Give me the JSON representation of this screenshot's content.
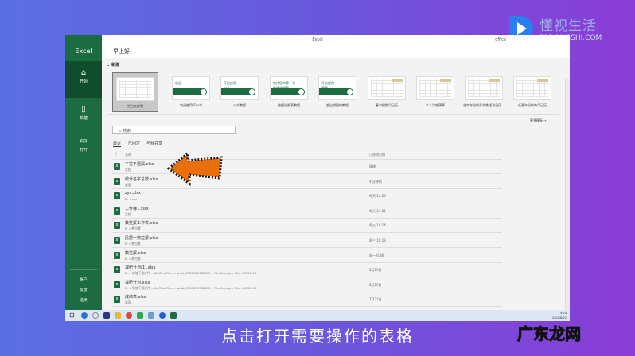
{
  "window": {
    "title": "Excel",
    "greeting": "早上好",
    "user": "office"
  },
  "sidebar": {
    "brand": "Excel",
    "items": [
      {
        "label": "开始",
        "icon": "home-icon"
      },
      {
        "label": "新建",
        "icon": "new-file-icon"
      },
      {
        "label": "打开",
        "icon": "folder-icon"
      }
    ],
    "footer": [
      "帐户",
      "反馈",
      "选项"
    ]
  },
  "new_section": {
    "label": "新建",
    "more": "更多模板 →",
    "templates": [
      {
        "label": "空白工作簿",
        "thumb": ""
      },
      {
        "label": "欢迎使用 Excel",
        "thumb": "欢迎"
      },
      {
        "label": "公式教程",
        "thumb": "开始使用\n公式"
      },
      {
        "label": "数据透视表教程",
        "thumb": "制作您的第一张\n数据透视表"
      },
      {
        "label": "超出饼图的教程",
        "thumb": "开始使用\n图表"
      },
      {
        "label": "春节假期月日历",
        "thumb": ""
      },
      {
        "label": "个人月度预算",
        "thumb": ""
      },
      {
        "label": "任何年份的季节性活动日历...",
        "thumb": ""
      },
      {
        "label": "任意年份的每月日历",
        "thumb": ""
      }
    ]
  },
  "search": {
    "placeholder": "搜索"
  },
  "tabs": [
    "最近",
    "已固定",
    "与我共享"
  ],
  "files": {
    "col_name": "名称",
    "col_date": "已修改日期",
    "rows": [
      {
        "name": "下拉不遗漏.xlsx",
        "path": "文档",
        "date": "刚刚"
      },
      {
        "name": "统计名字总数.xlsx",
        "path": "桌面",
        "date": "4 分钟前"
      },
      {
        "name": "zyc.xlsx",
        "path": "D: » zyc",
        "date": "昨天 14:26"
      },
      {
        "name": "工作簿1.xlsx",
        "path": "文档",
        "date": "昨天 14:21"
      },
      {
        "name": "数拉蒙工作表.xlsx",
        "path": "E: » 数拉蒙",
        "date": "周三 19:14"
      },
      {
        "name": "民居一数拉蒙.xlsx",
        "path": "E: » 数拉蒙",
        "date": "周三 19:13"
      },
      {
        "name": "数拉蒙.xlsx",
        "path": "E: » 数拉蒙",
        "date": "周一 6:36"
      },
      {
        "name": "减肥计划(1).xlsx",
        "path": "D: » 微信下载文件 » WeChat Files » wxid_8338651386412 » FileStorage » File » 2021-08",
        "date": "8月10日"
      },
      {
        "name": "减肥计划.xlsx",
        "path": "D: » 微信下载文件 » WeChat Files » wxid_8338651386412 » FileStorage » File » 2021-08",
        "date": "8月10日"
      },
      {
        "name": "成绩表.xlsx",
        "path": "桌面",
        "date": "7月22日"
      }
    ]
  },
  "taskbar": {
    "time": "9:24",
    "date": "2021/8/21"
  },
  "caption": "点击打开需要操作的表格",
  "watermark": {
    "brand": "懂视生活",
    "site": "51DONGSHI.COM",
    "corner": "广东龙网"
  },
  "colors": {
    "excel_green": "#1d6b40",
    "arrow": "#e8700a"
  }
}
